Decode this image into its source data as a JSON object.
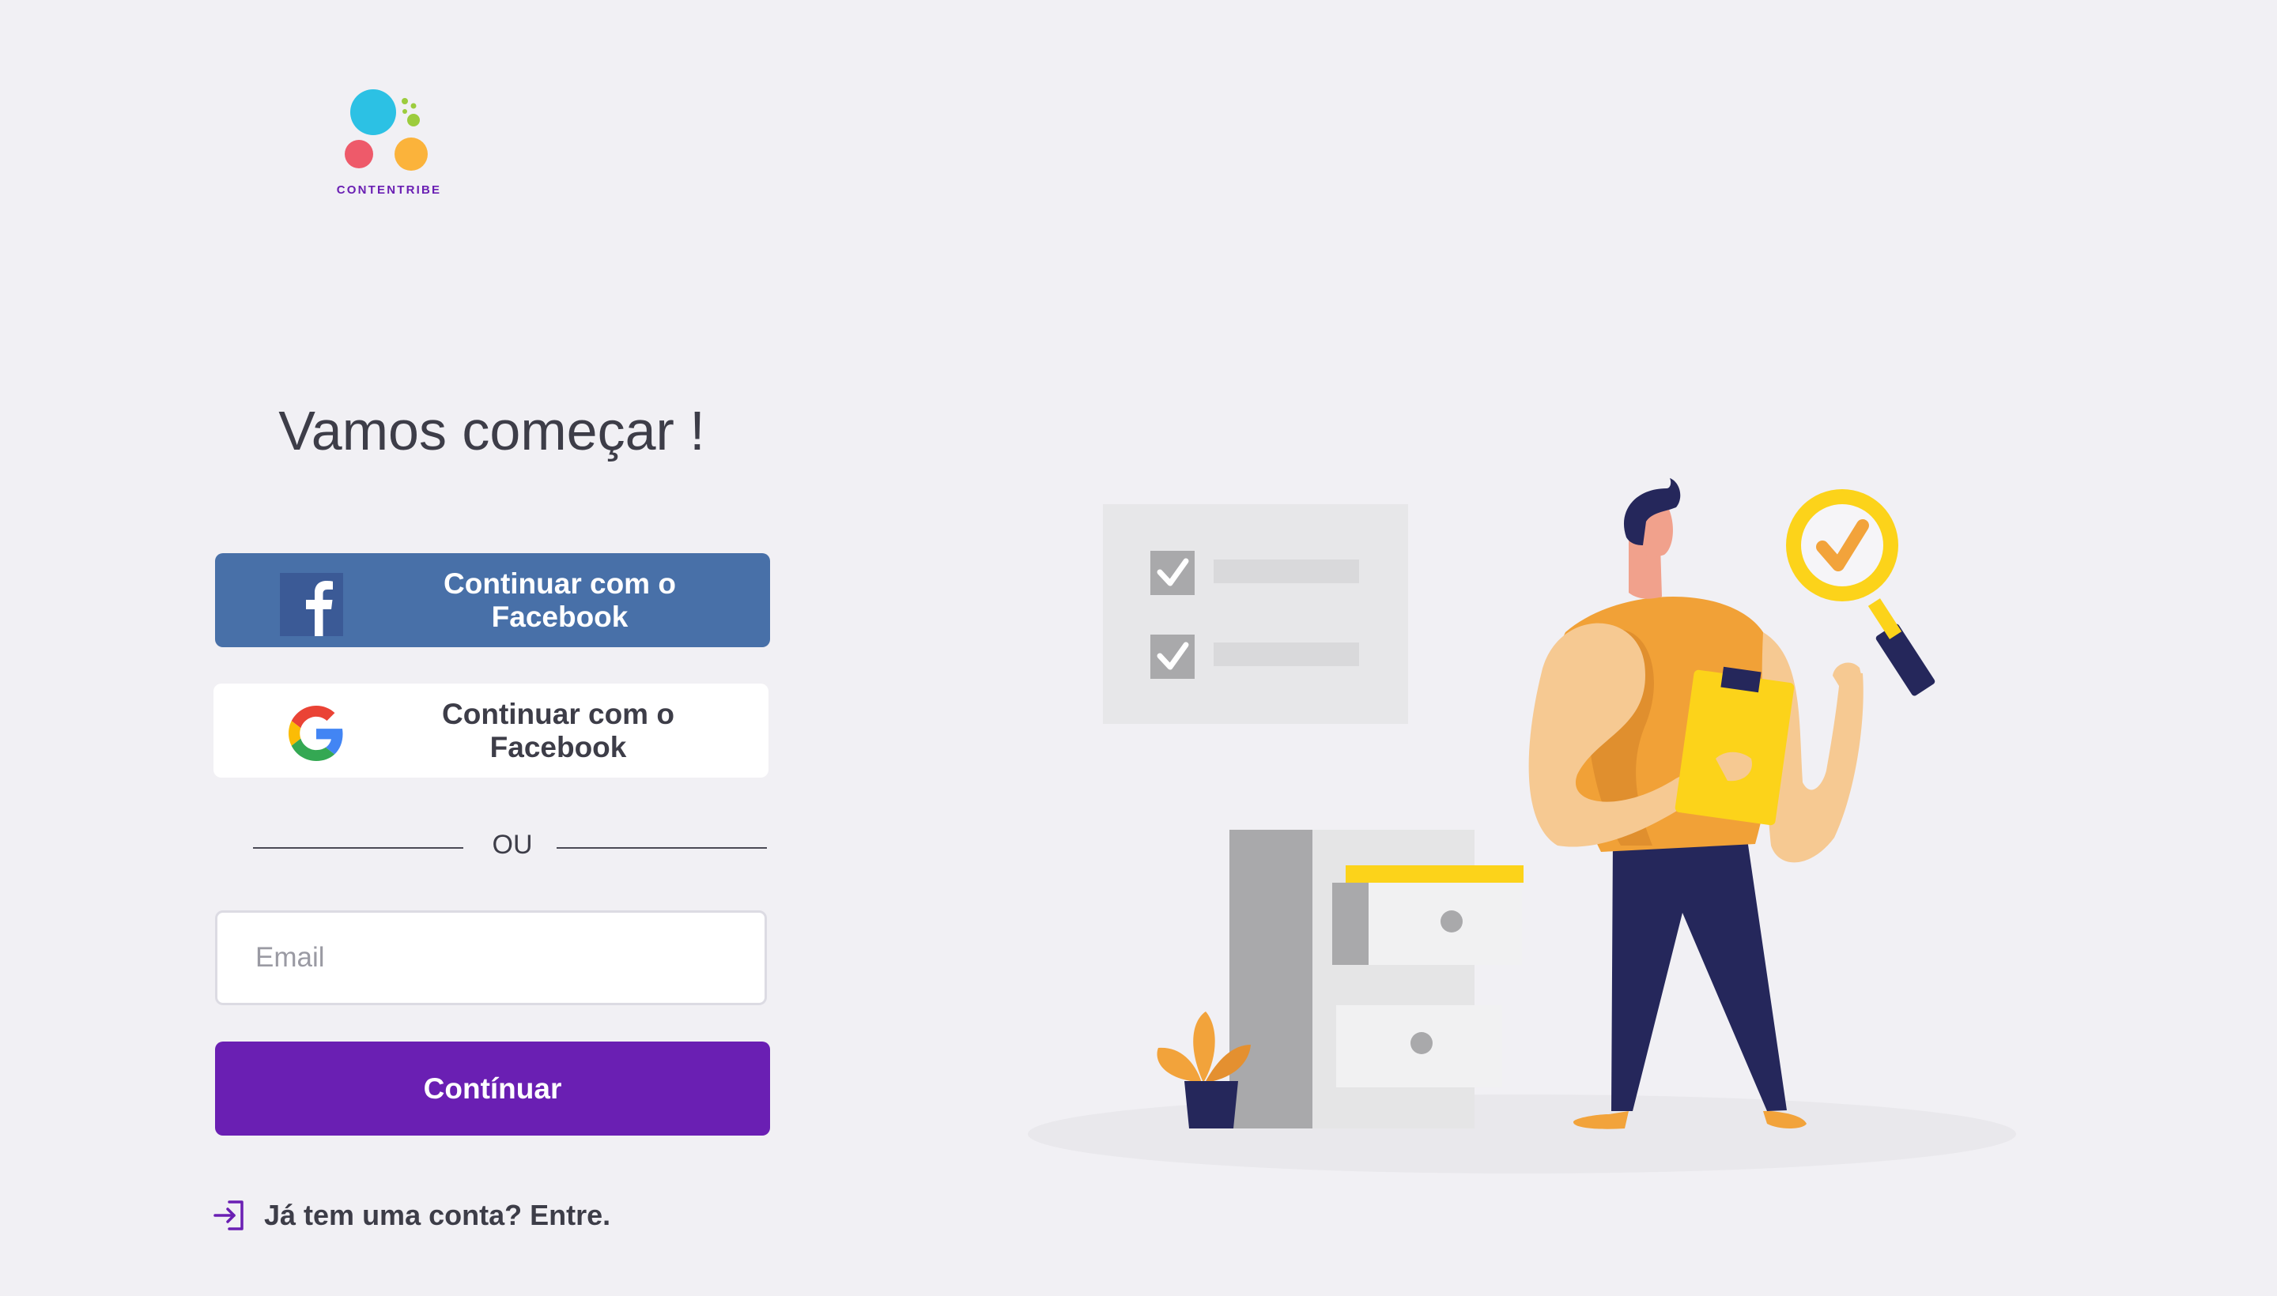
{
  "brand": {
    "name": "CONTENTRIBE"
  },
  "heading": "Vamos começar !",
  "social": {
    "facebook_label": "Continuar com o Facebook",
    "google_label": "Continuar com o Facebook"
  },
  "divider_text": "OU",
  "email": {
    "placeholder": "Email",
    "value": ""
  },
  "continue_label": "Contínuar",
  "login_link": "Já tem uma conta? Entre.",
  "icons": [
    "facebook-icon",
    "google-icon",
    "login-icon",
    "logo-icon"
  ],
  "colors": {
    "background": "#f1f0f4",
    "facebook": "#4870a8",
    "primary": "#6a1fb3",
    "logo_blue": "#2cc1e4",
    "logo_red": "#ee5a6a",
    "logo_orange": "#fbb33b",
    "logo_green": "#9ccc3d"
  }
}
